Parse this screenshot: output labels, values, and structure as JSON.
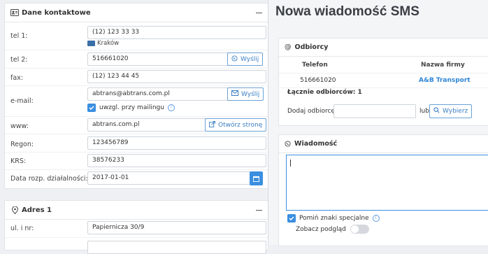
{
  "contact": {
    "title": "Dane kontaktowe",
    "tel1_label": "tel 1:",
    "tel1_value": "(12) 123 33 33",
    "tel1_city": "Kraków",
    "tel2_label": "tel 2:",
    "tel2_value": "516661020",
    "send_label": "Wyślij",
    "fax_label": "fax:",
    "fax_value": "(12) 123 44 45",
    "email_label": "e-mail:",
    "email_value": "abtrans@abtrans.com.pl",
    "email_send_label": "Wyślij",
    "mailing_label": "uwzgl. przy mailingu",
    "www_label": "www:",
    "www_value": "abtrans.com.pl",
    "open_page_label": "Otwórz stronę",
    "regon_label": "Regon:",
    "regon_value": "123456789",
    "krs_label": "KRS:",
    "krs_value": "38576233",
    "start_label": "Data rozp. działalności:",
    "start_value": "2017-01-01"
  },
  "address": {
    "title": "Adres 1",
    "street_label": "ul. i nr:",
    "street_value": "Papiernicza 30/9"
  },
  "sms": {
    "title": "Nowa wiadomość SMS",
    "recipients_title": "Odbiorcy",
    "col_phone": "Telefon",
    "col_company": "Nazwa firmy",
    "row_phone": "516661020",
    "row_company": "A&B Transport",
    "total_label": "Łącznie odbiorców: 1",
    "add_label": "Dodaj odbiorcę:",
    "add_value": "",
    "or_label": "lub",
    "choose_label": "Wybierz",
    "message_title": "Wiadomość",
    "message_value": "",
    "skip_special_label": "Pomiń znaki specjalne",
    "preview_label": "Zobacz podgląd"
  },
  "colors": {
    "accent": "#3b8fe0",
    "link": "#3b7fc4",
    "company": "#2f86d6"
  }
}
